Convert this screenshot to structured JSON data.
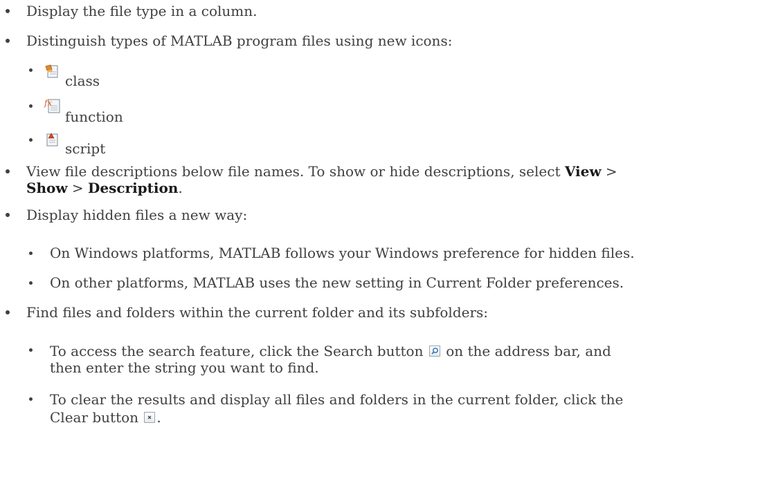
{
  "list": {
    "item1": "Display the file type in a column.",
    "item2": "Distinguish types of MATLAB program files using new icons:",
    "icons": {
      "class_label": "class",
      "function_label": "function",
      "script_label": "script"
    },
    "item3_pre": "View file descriptions below file names. To show or hide descriptions, select ",
    "item3_view": "View",
    "item3_gt1": " >",
    "item3_show": "Show",
    "item3_gt2": " > ",
    "item3_desc": "Description",
    "item3_end": ".",
    "item4": "Display hidden files a new way:",
    "item4_sub1": "On Windows platforms, MATLAB follows your Windows preference for hidden files.",
    "item4_sub2": "On other platforms, MATLAB uses the new setting in Current Folder preferences.",
    "item5": "Find files and folders within the current folder and its subfolders:",
    "item5_sub1_pre": "To access the search feature, click the Search button",
    "item5_sub1_post": " on the address bar, and",
    "item5_sub1_line2": "then enter the string you want to find.",
    "item5_sub2_line1": "To clear the results and display all files and folders in the current folder, click the",
    "item5_sub2_line2_pre": "Clear button",
    "item5_sub2_line2_post": "."
  },
  "colors": {
    "text": "#404040",
    "bold": "#1a1a1a"
  }
}
